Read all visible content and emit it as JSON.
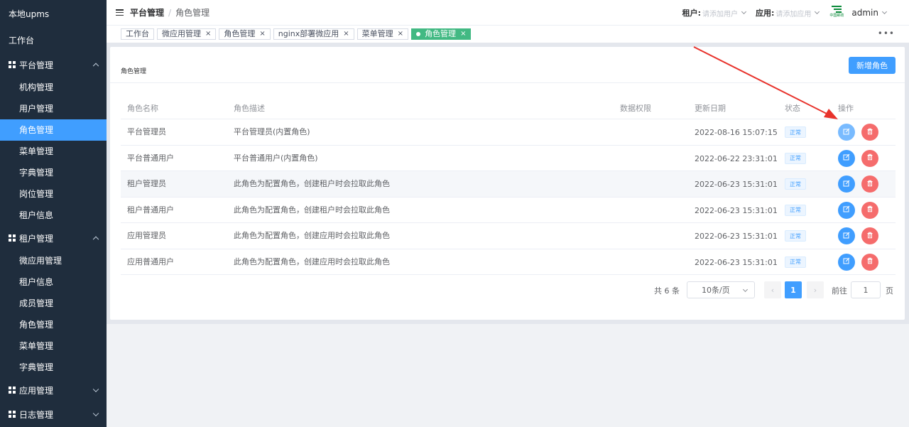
{
  "sidebar": {
    "brand": "本地upms",
    "workbench": "工作台",
    "groups": [
      {
        "label": "平台管理",
        "expanded": true
      },
      {
        "label": "租户管理",
        "expanded": true
      },
      {
        "label": "应用管理",
        "expanded": false
      },
      {
        "label": "日志管理",
        "expanded": false
      }
    ],
    "platform_items": [
      "机构管理",
      "用户管理",
      "角色管理",
      "菜单管理",
      "字典管理",
      "岗位管理",
      "租户信息"
    ],
    "tenant_items": [
      "微应用管理",
      "租户信息",
      "成员管理",
      "角色管理",
      "菜单管理",
      "字典管理"
    ],
    "active_item": "角色管理"
  },
  "header": {
    "breadcrumb_root": "平台管理",
    "breadcrumb_sep": "/",
    "breadcrumb_current": "角色管理",
    "tenant_label": "租户:",
    "tenant_placeholder": "请添加用户",
    "app_label": "应用:",
    "app_placeholder": "请添加应用",
    "logo_text": "中国邮政",
    "user": "admin"
  },
  "tags": {
    "items": [
      {
        "label": "工作台",
        "closable": false
      },
      {
        "label": "微应用管理",
        "closable": true
      },
      {
        "label": "角色管理",
        "closable": true
      },
      {
        "label": "nginx部署微应用",
        "closable": true
      },
      {
        "label": "菜单管理",
        "closable": true
      },
      {
        "label": "角色管理",
        "closable": true,
        "active": true
      }
    ],
    "close_glyph": "×",
    "more_glyph": "•••"
  },
  "card": {
    "title": "角色管理",
    "add_button": "新增角色"
  },
  "table": {
    "columns": [
      "角色名称",
      "角色描述",
      "数据权限",
      "更新日期",
      "状态",
      "操作"
    ],
    "rows": [
      {
        "name": "平台管理员",
        "desc": "平台管理员(内置角色)",
        "perm": "",
        "date": "2022-08-16 15:07:15",
        "status": "正常"
      },
      {
        "name": "平台普通用户",
        "desc": "平台普通用户(内置角色)",
        "perm": "",
        "date": "2022-06-22 23:31:01",
        "status": "正常"
      },
      {
        "name": "租户管理员",
        "desc": "此角色为配置角色，创建租户时会拉取此角色",
        "perm": "",
        "date": "2022-06-23 15:31:01",
        "status": "正常"
      },
      {
        "name": "租户普通用户",
        "desc": "此角色为配置角色，创建租户时会拉取此角色",
        "perm": "",
        "date": "2022-06-23 15:31:01",
        "status": "正常"
      },
      {
        "name": "应用管理员",
        "desc": "此角色为配置角色，创建应用时会拉取此角色",
        "perm": "",
        "date": "2022-06-23 15:31:01",
        "status": "正常"
      },
      {
        "name": "应用普通用户",
        "desc": "此角色为配置角色，创建应用时会拉取此角色",
        "perm": "",
        "date": "2022-06-23 15:31:01",
        "status": "正常"
      }
    ]
  },
  "pagination": {
    "total": "共 6 条",
    "page_size": "10条/页",
    "prev": "‹",
    "next": "›",
    "current": "1",
    "goto_label": "前往",
    "goto_value": "1",
    "page_unit": "页"
  },
  "colors": {
    "sidebar_bg": "#1f2d3d",
    "accent": "#409eff",
    "active_tag": "#42b983",
    "danger": "#f56c6c",
    "annotation_arrow": "#e8322b"
  }
}
